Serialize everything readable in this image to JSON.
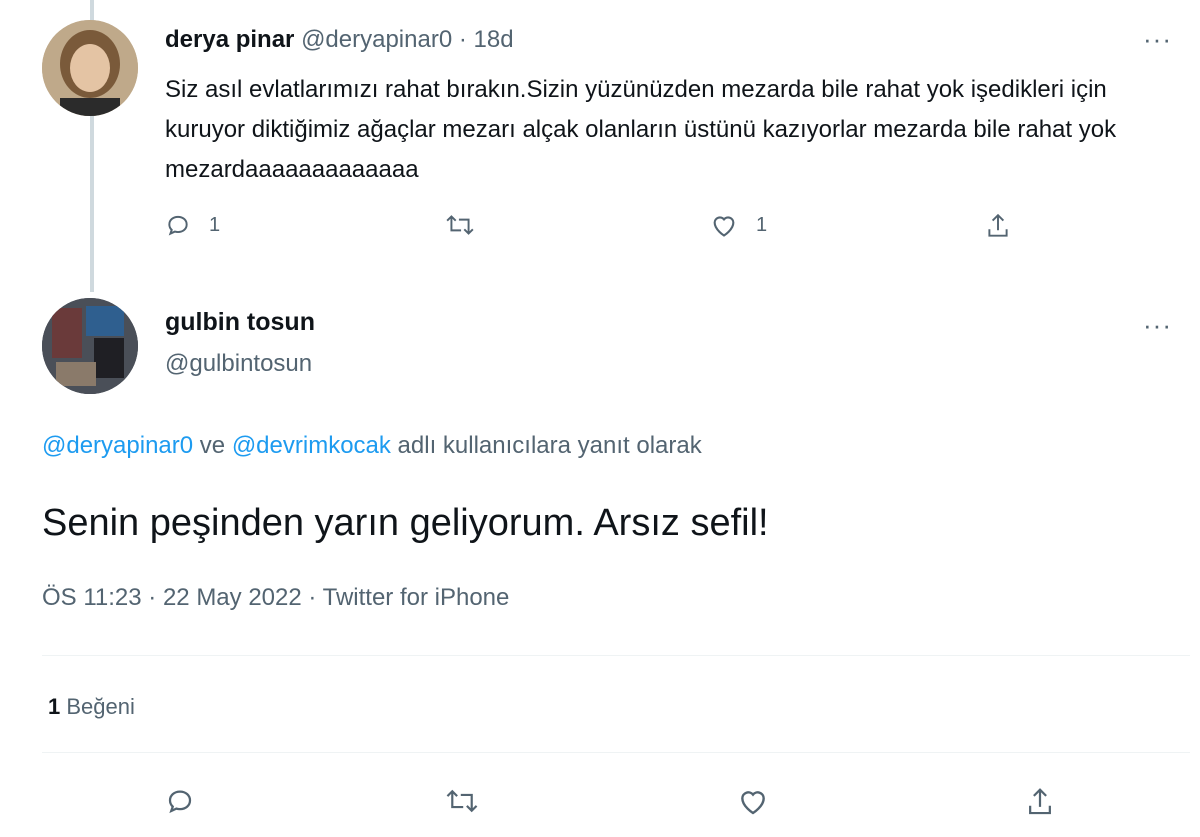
{
  "tweet1": {
    "name": "derya pinar",
    "handle": "@deryapinar0",
    "separator": "·",
    "time": "18d",
    "more": "···",
    "text": "Siz asıl evlatlarımızı rahat bırakın.Sizin yüzünüzden mezarda bile rahat yok işedikleri için kuruyor diktiğimiz ağaçlar mezarı alçak olanların üstünü kazıyorlar mezarda bile rahat yok mezardaaaaaaaaaaaaa",
    "actions": {
      "reply_count": "1",
      "retweet_count": "",
      "like_count": "1"
    }
  },
  "tweet2": {
    "name": "gulbin tosun",
    "handle": "@gulbintosun",
    "more": "···",
    "reply_to": {
      "user1": "@deryapinar0",
      "conj": " ve ",
      "user2": "@devrimkocak",
      "suffix": " adlı kullanıcılara yanıt olarak"
    },
    "text": "Senin peşinden yarın geliyorum. Arsız sefil!",
    "meta": "ÖS 11:23 · 22 May 2022 · Twitter for iPhone",
    "likes_count": "1",
    "likes_label": " Beğeni"
  },
  "icons": [
    "reply-icon",
    "retweet-icon",
    "like-icon",
    "share-icon"
  ],
  "colors": {
    "link": "#1d9bf0",
    "muted": "#536471",
    "text": "#0f1419"
  }
}
